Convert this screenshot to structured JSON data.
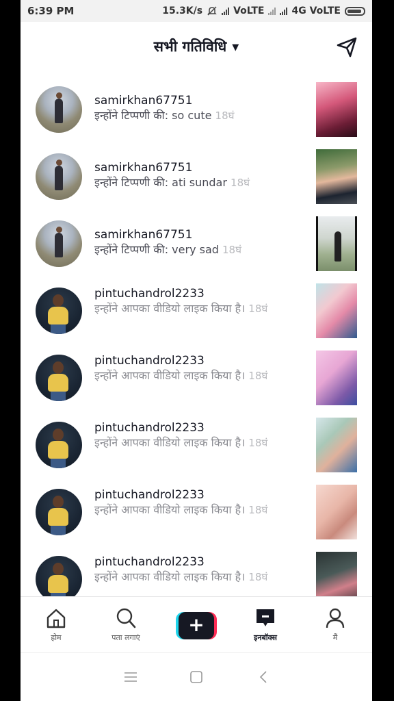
{
  "status_bar": {
    "time": "6:39 PM",
    "network_speed": "15.3K/s",
    "sim1": "VoLTE",
    "sim2": "4G VoLTE"
  },
  "header": {
    "title": "सभी गतिविधि",
    "title_icon": "caret-down-icon",
    "action_icon": "send-icon"
  },
  "notifications": [
    {
      "username": "samirkhan67751",
      "message": "इन्होंने टिप्पणी की: so cute",
      "time": "18घं",
      "avatar": "field",
      "thumb": "t1"
    },
    {
      "username": "samirkhan67751",
      "message": "इन्होंने टिप्पणी की: ati sundar",
      "time": "18घं",
      "avatar": "field",
      "thumb": "t2"
    },
    {
      "username": "samirkhan67751",
      "message": "इन्होंने टिप्पणी की: very sad",
      "time": "18घं",
      "avatar": "field",
      "thumb": "t3"
    },
    {
      "username": "pintuchandrol2233",
      "message": "इन्होंने आपका वीडियो लाइक किया है।",
      "time": "18घं",
      "avatar": "dark",
      "thumb": "t4"
    },
    {
      "username": "pintuchandrol2233",
      "message": "इन्होंने आपका वीडियो लाइक किया है।",
      "time": "18घं",
      "avatar": "dark",
      "thumb": "t5"
    },
    {
      "username": "pintuchandrol2233",
      "message": "इन्होंने आपका वीडियो लाइक किया है।",
      "time": "18घं",
      "avatar": "dark",
      "thumb": "t6"
    },
    {
      "username": "pintuchandrol2233",
      "message": "इन्होंने आपका वीडियो लाइक किया है।",
      "time": "18घं",
      "avatar": "dark",
      "thumb": "t7"
    },
    {
      "username": "pintuchandrol2233",
      "message": "इन्होंने आपका वीडियो लाइक किया है।",
      "time": "18घं",
      "avatar": "dark",
      "thumb": "t8"
    }
  ],
  "bottom_nav": {
    "home": "होम",
    "discover": "पता लगाएं",
    "create": "+",
    "inbox": "इनबॉक्स",
    "me": "मैं",
    "active": "inbox"
  },
  "colors": {
    "accent_cyan": "#20d5ec",
    "accent_red": "#fe2c55",
    "text_primary": "#161823"
  }
}
